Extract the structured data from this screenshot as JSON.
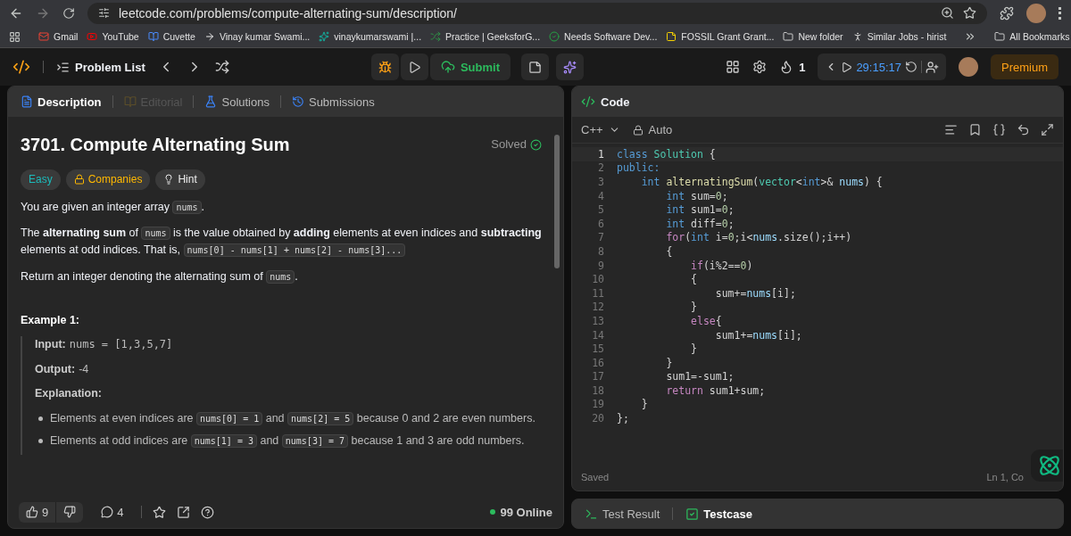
{
  "browser": {
    "url": "leetcode.com/problems/compute-alternating-sum/description/"
  },
  "bookmarks": [
    {
      "label": "Gmail",
      "kind": "site"
    },
    {
      "label": "YouTube",
      "kind": "site"
    },
    {
      "label": "Cuvette",
      "kind": "site"
    },
    {
      "label": "Vinay kumar Swami...",
      "kind": "site"
    },
    {
      "label": "vinaykumarswami |...",
      "kind": "site"
    },
    {
      "label": "Practice | GeeksforG...",
      "kind": "site"
    },
    {
      "label": "Needs Software Dev...",
      "kind": "site"
    },
    {
      "label": "FOSSIL Grant Grant...",
      "kind": "site"
    },
    {
      "label": "New folder",
      "kind": "folder"
    },
    {
      "label": "Similar Jobs - hirist",
      "kind": "site"
    }
  ],
  "all_bookmarks": "All Bookmarks",
  "nav": {
    "problem_list": "Problem List",
    "submit": "Submit",
    "streak": "1",
    "timer": "29:15:17",
    "premium": "Premium"
  },
  "left_tabs": [
    {
      "label": "Description",
      "selected": true,
      "disabled": false
    },
    {
      "label": "Editorial",
      "selected": false,
      "disabled": true
    },
    {
      "label": "Solutions",
      "selected": false,
      "disabled": false
    },
    {
      "label": "Submissions",
      "selected": false,
      "disabled": false
    }
  ],
  "problem": {
    "title": "3701. Compute Alternating Sum",
    "status": "Solved",
    "difficulty": "Easy",
    "companies": "Companies",
    "hint": "Hint",
    "paragraphs": [
      [
        {
          "kind": "text",
          "text": "You are given an integer array "
        },
        {
          "kind": "code",
          "text": "nums"
        },
        {
          "kind": "text",
          "text": "."
        }
      ],
      [
        {
          "kind": "text",
          "text": "The "
        },
        {
          "kind": "bold",
          "text": "alternating sum"
        },
        {
          "kind": "text",
          "text": " of "
        },
        {
          "kind": "code",
          "text": "nums"
        },
        {
          "kind": "text",
          "text": " is the value obtained by "
        },
        {
          "kind": "bold",
          "text": "adding"
        },
        {
          "kind": "text",
          "text": " elements at even indices and "
        },
        {
          "kind": "bold",
          "text": "subtracting"
        },
        {
          "kind": "text",
          "text": " elements at odd indices. That is, "
        },
        {
          "kind": "code",
          "text": "nums[0] - nums[1] + nums[2] - nums[3]..."
        }
      ],
      [
        {
          "kind": "text",
          "text": "Return an integer denoting the alternating sum of "
        },
        {
          "kind": "code",
          "text": "nums"
        },
        {
          "kind": "text",
          "text": "."
        }
      ]
    ],
    "example": {
      "heading": "Example 1:",
      "input_label": "Input:",
      "input": "nums = [1,3,5,7]",
      "output_label": "Output:",
      "output": "-4",
      "explanation_label": "Explanation:",
      "bullets": [
        [
          {
            "kind": "text",
            "text": "Elements at even indices are "
          },
          {
            "kind": "code",
            "text": "nums[0] = 1"
          },
          {
            "kind": "text",
            "text": " and "
          },
          {
            "kind": "code",
            "text": "nums[2] = 5"
          },
          {
            "kind": "text",
            "text": " because 0 and 2 are even numbers."
          }
        ],
        [
          {
            "kind": "text",
            "text": "Elements at odd indices are "
          },
          {
            "kind": "code",
            "text": "nums[1] = 3"
          },
          {
            "kind": "text",
            "text": " and "
          },
          {
            "kind": "code",
            "text": "nums[3] = 7"
          },
          {
            "kind": "text",
            "text": " because 1 and 3 are odd numbers."
          }
        ]
      ]
    }
  },
  "left_footer": {
    "likes": "9",
    "comments": "4",
    "online": "99 Online"
  },
  "code_panel": {
    "title": "Code",
    "language": "C++",
    "mode": "Auto",
    "status": "Saved",
    "position": "Ln 1, Co",
    "lines": [
      {
        "n": "1",
        "current": true,
        "tokens": [
          {
            "kind": "kw",
            "text": "class "
          },
          {
            "kind": "type",
            "text": "Solution"
          },
          {
            "kind": "p",
            "text": " {"
          }
        ]
      },
      {
        "n": "2",
        "current": false,
        "tokens": [
          {
            "kind": "kw",
            "text": "public:"
          }
        ]
      },
      {
        "n": "3",
        "current": false,
        "tokens": [
          {
            "kind": "kw",
            "text": "    int "
          },
          {
            "kind": "fn",
            "text": "alternatingSum"
          },
          {
            "kind": "p",
            "text": "("
          },
          {
            "kind": "type",
            "text": "vector"
          },
          {
            "kind": "p",
            "text": "<"
          },
          {
            "kind": "kw",
            "text": "int"
          },
          {
            "kind": "p",
            "text": ">& "
          },
          {
            "kind": "var",
            "text": "nums"
          },
          {
            "kind": "p",
            "text": ") {"
          }
        ]
      },
      {
        "n": "4",
        "current": false,
        "tokens": [
          {
            "kind": "kw",
            "text": "        int "
          },
          {
            "kind": "p",
            "text": "sum="
          },
          {
            "kind": "num",
            "text": "0"
          },
          {
            "kind": "p",
            "text": ";"
          }
        ]
      },
      {
        "n": "5",
        "current": false,
        "tokens": [
          {
            "kind": "kw",
            "text": "        int "
          },
          {
            "kind": "p",
            "text": "sum1="
          },
          {
            "kind": "num",
            "text": "0"
          },
          {
            "kind": "p",
            "text": ";"
          }
        ]
      },
      {
        "n": "6",
        "current": false,
        "tokens": [
          {
            "kind": "kw",
            "text": "        int "
          },
          {
            "kind": "p",
            "text": "diff="
          },
          {
            "kind": "num",
            "text": "0"
          },
          {
            "kind": "p",
            "text": ";"
          }
        ]
      },
      {
        "n": "7",
        "current": false,
        "tokens": [
          {
            "kind": "ctrl",
            "text": "        for"
          },
          {
            "kind": "p",
            "text": "("
          },
          {
            "kind": "kw",
            "text": "int "
          },
          {
            "kind": "p",
            "text": "i="
          },
          {
            "kind": "num",
            "text": "0"
          },
          {
            "kind": "p",
            "text": ";i<"
          },
          {
            "kind": "var",
            "text": "nums"
          },
          {
            "kind": "p",
            "text": ".size();i++)"
          }
        ]
      },
      {
        "n": "8",
        "current": false,
        "tokens": [
          {
            "kind": "p",
            "text": "        {"
          }
        ]
      },
      {
        "n": "9",
        "current": false,
        "tokens": [
          {
            "kind": "ctrl",
            "text": "            if"
          },
          {
            "kind": "p",
            "text": "(i%2=="
          },
          {
            "kind": "num",
            "text": "0"
          },
          {
            "kind": "p",
            "text": ")"
          }
        ]
      },
      {
        "n": "10",
        "current": false,
        "tokens": [
          {
            "kind": "p",
            "text": "            {"
          }
        ]
      },
      {
        "n": "11",
        "current": false,
        "tokens": [
          {
            "kind": "p",
            "text": "                sum+="
          },
          {
            "kind": "var",
            "text": "nums"
          },
          {
            "kind": "p",
            "text": "[i];"
          }
        ]
      },
      {
        "n": "12",
        "current": false,
        "tokens": [
          {
            "kind": "p",
            "text": "            }"
          }
        ]
      },
      {
        "n": "13",
        "current": false,
        "tokens": [
          {
            "kind": "ctrl",
            "text": "            else"
          },
          {
            "kind": "p",
            "text": "{"
          }
        ]
      },
      {
        "n": "14",
        "current": false,
        "tokens": [
          {
            "kind": "p",
            "text": "                sum1+="
          },
          {
            "kind": "var",
            "text": "nums"
          },
          {
            "kind": "p",
            "text": "[i];"
          }
        ]
      },
      {
        "n": "15",
        "current": false,
        "tokens": [
          {
            "kind": "p",
            "text": "            }"
          }
        ]
      },
      {
        "n": "16",
        "current": false,
        "tokens": [
          {
            "kind": "p",
            "text": "        }"
          }
        ]
      },
      {
        "n": "17",
        "current": false,
        "tokens": [
          {
            "kind": "p",
            "text": "        sum1=-sum1;"
          }
        ]
      },
      {
        "n": "18",
        "current": false,
        "tokens": [
          {
            "kind": "ctrl",
            "text": "        return"
          },
          {
            "kind": "p",
            "text": " sum1+sum;"
          }
        ]
      },
      {
        "n": "19",
        "current": false,
        "tokens": [
          {
            "kind": "p",
            "text": "    }"
          }
        ]
      },
      {
        "n": "20",
        "current": false,
        "tokens": [
          {
            "kind": "p",
            "text": "};"
          }
        ]
      }
    ]
  },
  "bottom_tabs": [
    {
      "label": "Test Result",
      "selected": false
    },
    {
      "label": "Testcase",
      "selected": true
    }
  ]
}
